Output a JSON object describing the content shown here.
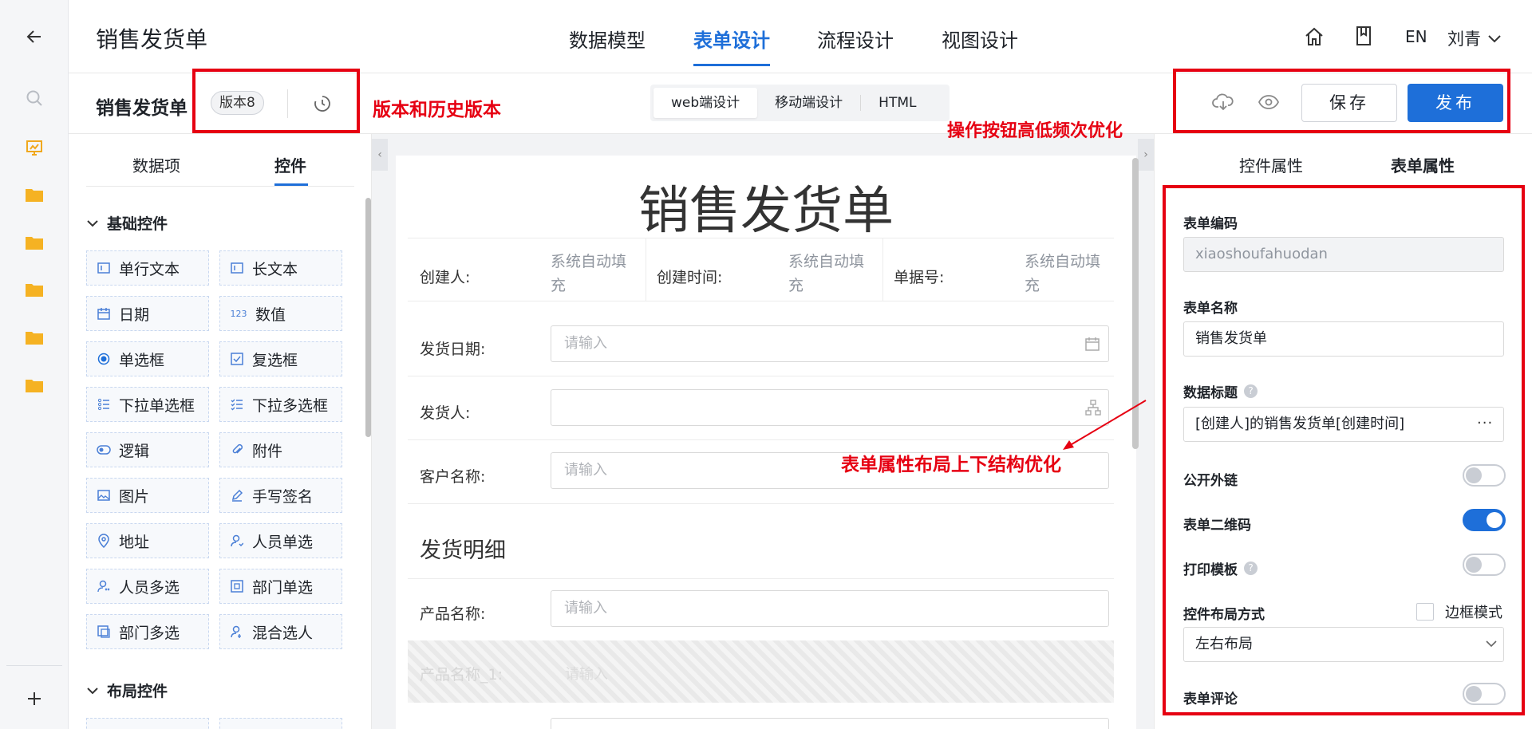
{
  "header": {
    "title": "销售发货单",
    "tabs": [
      {
        "label": "数据模型",
        "active": false
      },
      {
        "label": "表单设计",
        "active": true
      },
      {
        "label": "流程设计",
        "active": false
      },
      {
        "label": "视图设计",
        "active": false
      }
    ],
    "lang": "EN",
    "user": "刘青"
  },
  "toolbar": {
    "form_name": "销售发货单",
    "version": "版本8",
    "modes": [
      {
        "label": "web端设计",
        "active": true
      },
      {
        "label": "移动端设计",
        "active": false
      },
      {
        "label": "HTML",
        "active": false
      }
    ],
    "save_label": "保存",
    "publish_label": "发布"
  },
  "left_panel": {
    "tabs": [
      {
        "label": "数据项",
        "active": false
      },
      {
        "label": "控件",
        "active": true
      }
    ],
    "basic_group_title": "基础控件",
    "basic_controls": [
      {
        "label": "单行文本",
        "icon": "single-line-text-icon"
      },
      {
        "label": "长文本",
        "icon": "long-text-icon"
      },
      {
        "label": "日期",
        "icon": "date-icon"
      },
      {
        "label": "数值",
        "icon": "number-icon"
      },
      {
        "label": "单选框",
        "icon": "radio-icon"
      },
      {
        "label": "复选框",
        "icon": "checkbox-icon"
      },
      {
        "label": "下拉单选框",
        "icon": "dropdown-single-icon"
      },
      {
        "label": "下拉多选框",
        "icon": "dropdown-multi-icon"
      },
      {
        "label": "逻辑",
        "icon": "logic-toggle-icon"
      },
      {
        "label": "附件",
        "icon": "attachment-icon"
      },
      {
        "label": "图片",
        "icon": "image-icon"
      },
      {
        "label": "手写签名",
        "icon": "signature-icon"
      },
      {
        "label": "地址",
        "icon": "location-icon"
      },
      {
        "label": "人员单选",
        "icon": "user-single-icon"
      },
      {
        "label": "人员多选",
        "icon": "user-multi-icon"
      },
      {
        "label": "部门单选",
        "icon": "dept-single-icon"
      },
      {
        "label": "部门多选",
        "icon": "dept-multi-icon"
      },
      {
        "label": "混合选人",
        "icon": "mixed-user-icon"
      }
    ],
    "layout_group_title": "布局控件"
  },
  "canvas": {
    "title": "销售发货单",
    "meta_fields": [
      {
        "label": "创建人:",
        "value_line1": "系统自动填",
        "value_line2": "充"
      },
      {
        "label": "创建时间:",
        "value_line1": "系统自动填",
        "value_line2": "充"
      },
      {
        "label": "单据号:",
        "value_line1": "系统自动填",
        "value_line2": "充"
      }
    ],
    "fields": [
      {
        "label": "发货日期:",
        "placeholder": "请输入"
      },
      {
        "label": "发货人:",
        "placeholder": ""
      },
      {
        "label": "客户名称:",
        "placeholder": "请输入"
      }
    ],
    "section_title": "发货明细",
    "detail_fields": [
      {
        "label": "产品名称:",
        "placeholder": "请输入"
      },
      {
        "label": "产品名称_1:",
        "placeholder": "请输入"
      }
    ]
  },
  "right_panel": {
    "tabs": [
      {
        "label": "控件属性",
        "active": false
      },
      {
        "label": "表单属性",
        "active": true
      }
    ],
    "form_code_label": "表单编码",
    "form_code_value": "xiaoshoufahuodan",
    "form_name_label": "表单名称",
    "form_name_value": "销售发货单",
    "data_title_label": "数据标题",
    "data_title_value": "[创建人]的销售发货单[创建时间]",
    "public_link_label": "公开外链",
    "public_link_on": false,
    "qr_label": "表单二维码",
    "qr_on": true,
    "print_label": "打印模板",
    "print_on": false,
    "layout_label": "控件布局方式",
    "border_mode_label": "边框模式",
    "layout_value": "左右布局",
    "comment_label": "表单评论",
    "comment_on": false
  },
  "annotations": {
    "version_note": "版本和历史版本",
    "buttons_note": "操作按钮高低频次优化",
    "layout_note": "表单属性布局上下结构优化"
  },
  "colors": {
    "accent": "#1e6fd9",
    "annotation": "#e60012",
    "folder": "#f5b223"
  }
}
